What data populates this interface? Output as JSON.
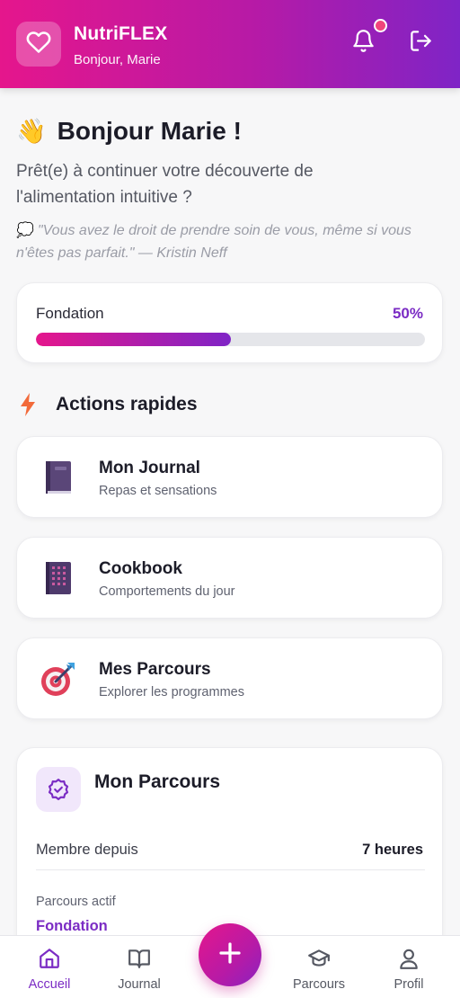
{
  "header": {
    "app_name": "NutriFLEX",
    "greeting": "Bonjour, Marie",
    "brand_gradient": [
      "#e5168c",
      "#7f24c6"
    ],
    "icons": {
      "logo": "heart-icon",
      "notifications": "bell-icon",
      "logout": "logout-icon"
    },
    "has_notification": true
  },
  "welcome": {
    "emoji": "👋",
    "title": "Bonjour Marie !",
    "subtitle": "Prêt(e) à continuer votre découverte de l'alimentation intuitive ?",
    "quote_icon": "💭",
    "quote": "\"Vous avez le droit de prendre soin de vous, même si vous n'êtes pas parfait.\" — Kristin Neff"
  },
  "progress": {
    "label": "Fondation",
    "percent_label": "50%",
    "value": 0.5
  },
  "quick_actions": {
    "title": "Actions rapides",
    "icon": "bolt-icon",
    "items": [
      {
        "title": "Mon Journal",
        "subtitle": "Repas et sensations",
        "icon": "journal-book-icon"
      },
      {
        "title": "Cookbook",
        "subtitle": "Comportements du jour",
        "icon": "cookbook-icon"
      },
      {
        "title": "Mes Parcours",
        "subtitle": "Explorer les programmes",
        "icon": "target-icon"
      }
    ]
  },
  "parcours": {
    "title": "Mon Parcours",
    "icon": "badge-check-icon",
    "member_label": "Membre depuis",
    "member_value": "7 heures",
    "active_label": "Parcours actif",
    "active_value": "Fondation"
  },
  "bottom_nav": {
    "items": [
      {
        "label": "Accueil",
        "icon": "home-icon",
        "active": true
      },
      {
        "label": "Journal",
        "icon": "book-open-icon",
        "active": false
      },
      {
        "label": "Parcours",
        "icon": "graduation-cap-icon",
        "active": false
      },
      {
        "label": "Profil",
        "icon": "user-icon",
        "active": false
      }
    ],
    "fab_icon": "plus-icon"
  },
  "colors": {
    "accent_purple": "#7b2cc4",
    "accent_pink": "#e5168c",
    "notification_dot": "#f0457b",
    "background": "#f7f7f8"
  }
}
